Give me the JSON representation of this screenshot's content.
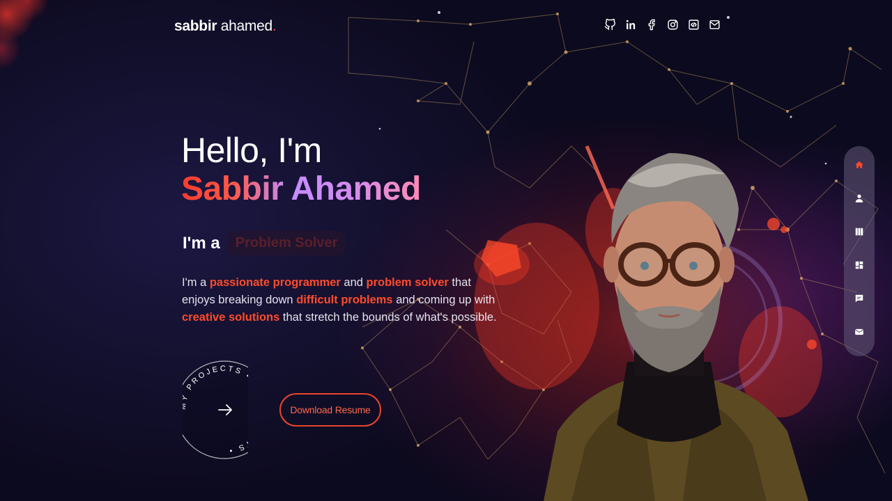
{
  "header": {
    "logo_first": "sabbir",
    "logo_last": "ahamed",
    "logo_dot": "."
  },
  "socials": [
    {
      "icon": "github-icon"
    },
    {
      "icon": "linkedin-icon"
    },
    {
      "icon": "facebook-icon"
    },
    {
      "icon": "instagram-icon"
    },
    {
      "icon": "code-icon"
    },
    {
      "icon": "mail-icon"
    }
  ],
  "hero": {
    "greeting": "Hello, I'm",
    "name": "Sabbir Ahamed",
    "role_prefix": "I'm a",
    "role": "Problem Solver",
    "bio": [
      {
        "t": "I'm a ",
        "hl": false
      },
      {
        "t": "passionate programmer",
        "hl": true
      },
      {
        "t": " and ",
        "hl": false
      },
      {
        "t": "problem solver",
        "hl": true
      },
      {
        "t": " that enjoys breaking down ",
        "hl": false
      },
      {
        "t": "difficult problems",
        "hl": true
      },
      {
        "t": " and coming up with ",
        "hl": false
      },
      {
        "t": "creative solutions",
        "hl": true
      },
      {
        "t": " that stretch the bounds of what's possible.",
        "hl": false
      }
    ],
    "projects_circle_text": "MY PROJECTS • MY PROJECTS •",
    "download_label": "Download Resume"
  },
  "side_nav": [
    {
      "icon": "home-icon",
      "active": true
    },
    {
      "icon": "user-icon",
      "active": false
    },
    {
      "icon": "columns-icon",
      "active": false
    },
    {
      "icon": "grid-icon",
      "active": false
    },
    {
      "icon": "chat-icon",
      "active": false
    },
    {
      "icon": "envelope-icon",
      "active": false
    }
  ],
  "colors": {
    "accent": "#ff4b2b",
    "background": "#0c0a1e",
    "nav_bg": "#645a78"
  }
}
